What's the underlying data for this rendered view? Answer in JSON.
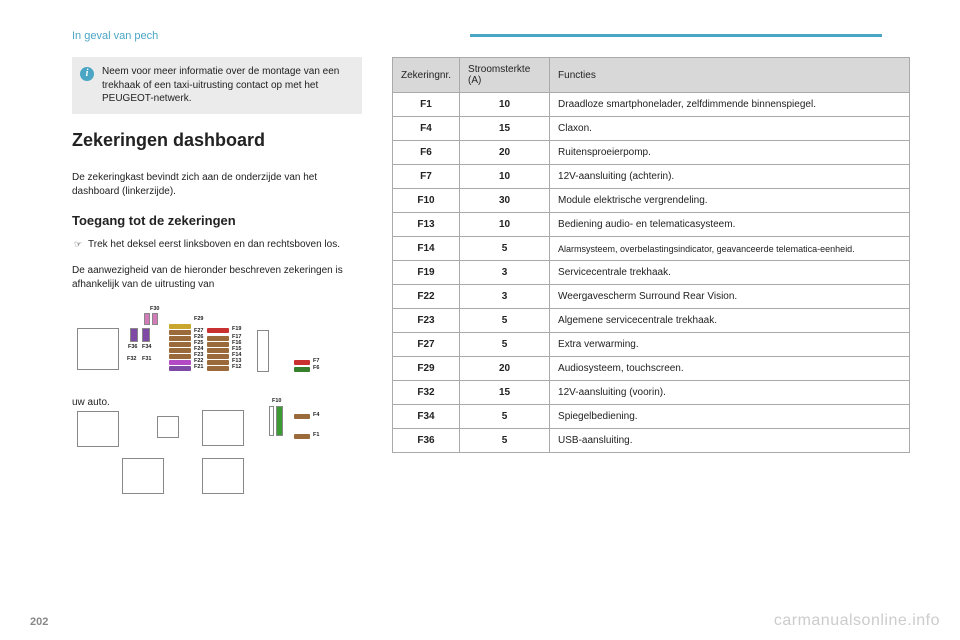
{
  "header": {
    "chapter": "In geval van pech"
  },
  "info_box": {
    "text": "Neem voor meer informatie over de montage van een trekhaak of een taxi-uitrusting contact op met het PEUGEOT-netwerk."
  },
  "section": {
    "title": "Zekeringen dashboard",
    "intro": "De zekeringkast bevindt zich aan de onderzijde van het dashboard (linkerzijde).",
    "sub_title": "Toegang tot de zekeringen",
    "bullet": "Trek het deksel eerst linksboven en dan rechtsboven los.",
    "note": "De aanwezigheid van de hieronder beschreven zekeringen is afhankelijk van de uitrusting van",
    "note_tail": "uw auto."
  },
  "diagram_labels": {
    "f1": "F1",
    "f4": "F4",
    "f6": "F6",
    "f7": "F7",
    "f10": "F10",
    "f12": "F12",
    "f13": "F13",
    "f14": "F14",
    "f15": "F15",
    "f16": "F16",
    "f17": "F17",
    "f19": "F19",
    "f21": "F21",
    "f22": "F22",
    "f23": "F23",
    "f24": "F24",
    "f25": "F25",
    "f26": "F26",
    "f27": "F27",
    "f29": "F29",
    "f30": "F30",
    "f31": "F31",
    "f32": "F32",
    "f34": "F34",
    "f36": "F36"
  },
  "table": {
    "head": {
      "c1": "Zekeringnr.",
      "c2": "Stroomsterkte (A)",
      "c3": "Functies"
    },
    "rows": [
      {
        "c1": "F1",
        "c2": "10",
        "c3": "Draadloze smartphonelader, zelfdimmende binnenspiegel."
      },
      {
        "c1": "F4",
        "c2": "15",
        "c3": "Claxon."
      },
      {
        "c1": "F6",
        "c2": "20",
        "c3": "Ruitensproeierpomp."
      },
      {
        "c1": "F7",
        "c2": "10",
        "c3": "12V-aansluiting (achterin)."
      },
      {
        "c1": "F10",
        "c2": "30",
        "c3": "Module elektrische vergrendeling."
      },
      {
        "c1": "F13",
        "c2": "10",
        "c3": "Bediening audio- en telematicasysteem."
      },
      {
        "c1": "F14",
        "c2": "5",
        "c3": "Alarmsysteem, overbelastingsindicator, geavanceerde telematica-eenheid."
      },
      {
        "c1": "F19",
        "c2": "3",
        "c3": "Servicecentrale trekhaak."
      },
      {
        "c1": "F22",
        "c2": "3",
        "c3": "Weergavescherm Surround Rear Vision."
      },
      {
        "c1": "F23",
        "c2": "5",
        "c3": "Algemene servicecentrale trekhaak."
      },
      {
        "c1": "F27",
        "c2": "5",
        "c3": "Extra verwarming."
      },
      {
        "c1": "F29",
        "c2": "20",
        "c3": "Audiosysteem, touchscreen."
      },
      {
        "c1": "F32",
        "c2": "15",
        "c3": "12V-aansluiting (voorin)."
      },
      {
        "c1": "F34",
        "c2": "5",
        "c3": "Spiegelbediening."
      },
      {
        "c1": "F36",
        "c2": "5",
        "c3": "USB-aansluiting."
      }
    ]
  },
  "footer": {
    "page": "202",
    "watermark": "carmanualsonline.info"
  }
}
